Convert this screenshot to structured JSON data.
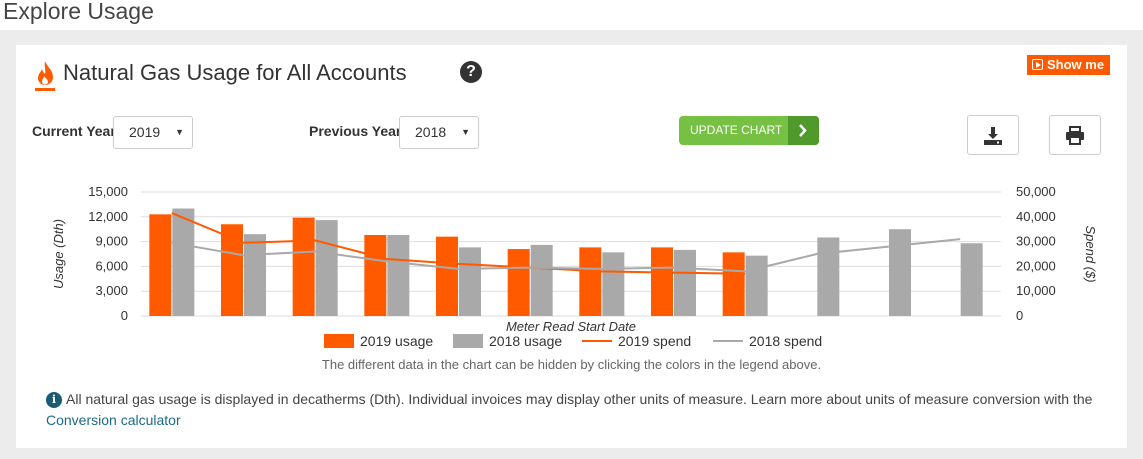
{
  "page": {
    "title": "Explore Usage"
  },
  "card": {
    "title": "Natural Gas Usage for All Accounts",
    "help_icon": "question-circle-icon",
    "show_me_label": "Show me"
  },
  "controls": {
    "current_year_label": "Current Year",
    "current_year_value": "2019",
    "previous_year_label": "Previous Year",
    "previous_year_value": "2018",
    "update_button_label": "UPDATE CHART",
    "download_icon": "download-icon",
    "print_icon": "print-icon"
  },
  "colors": {
    "usage_2019": "#ff5a00",
    "usage_2018": "#a9a9a9",
    "accent_green": "#76c043"
  },
  "chart_data": {
    "type": "bar",
    "xlabel": "Meter Read Start Date",
    "ylabel": "Usage (Dth)",
    "y2label": "Spend ($)",
    "ylim": [
      0,
      15000
    ],
    "y2lim": [
      0,
      50000
    ],
    "yticks": [
      "15,000",
      "12,000",
      "9,000",
      "6,000",
      "3,000",
      "0"
    ],
    "y2ticks": [
      "50,000",
      "40,000",
      "30,000",
      "20,000",
      "10,000",
      "0"
    ],
    "grid": true,
    "legend_position": "bottom",
    "categories": [
      "",
      "",
      "",
      "",
      "",
      "",
      "",
      "",
      "",
      "",
      "",
      ""
    ],
    "series": [
      {
        "name": "2019 usage",
        "kind": "bar",
        "axis": "left",
        "color": "#ff5a00",
        "values": [
          12300,
          11100,
          11900,
          9800,
          9600,
          8100,
          8300,
          8300,
          7700,
          null,
          null,
          null
        ]
      },
      {
        "name": "2018 usage",
        "kind": "bar",
        "axis": "left",
        "color": "#a9a9a9",
        "values": [
          13000,
          9900,
          11600,
          9800,
          8300,
          8600,
          7700,
          8000,
          7300,
          9500,
          10500,
          8800
        ]
      },
      {
        "name": "2019 spend",
        "kind": "line",
        "axis": "right",
        "color": "#ff5a00",
        "values": [
          41500,
          29500,
          30500,
          23000,
          21000,
          19500,
          18000,
          17500,
          17000,
          null,
          null,
          null
        ]
      },
      {
        "name": "2018 spend",
        "kind": "line",
        "axis": "right",
        "color": "#a9a9a9",
        "values": [
          29500,
          24500,
          26000,
          22000,
          19000,
          19500,
          19000,
          19500,
          18000,
          25000,
          28000,
          31000
        ]
      }
    ],
    "note": "The different data in the chart can be hidden by clicking the colors in the legend above."
  },
  "info": {
    "text": "All natural gas usage is displayed in decatherms (Dth). Individual invoices may display other units of measure. Learn more about units of measure conversion with the ",
    "link_label": "Conversion calculator"
  }
}
